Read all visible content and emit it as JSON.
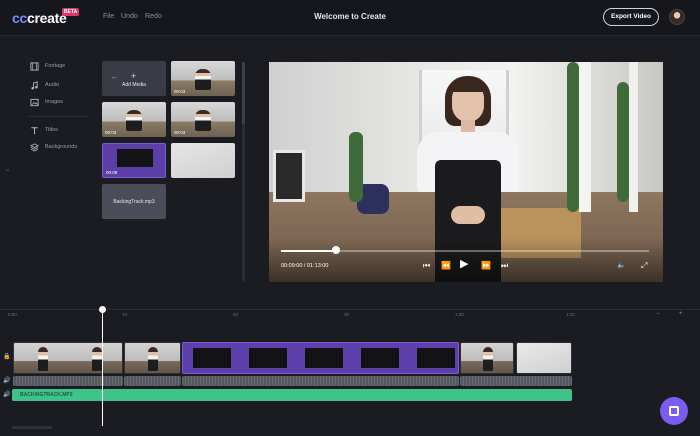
{
  "app": {
    "logo": "create",
    "logo_prefix": "cc",
    "badge": "BETA",
    "window_title": "Welcome to Create",
    "menu": [
      {
        "label": "File"
      },
      {
        "label": "Undo"
      },
      {
        "label": "Redo"
      }
    ],
    "export_label": "Export Video",
    "accent_color": "#7a5cf0"
  },
  "sidebar": {
    "items": [
      {
        "label": "Footage",
        "icon": "film-icon"
      },
      {
        "label": "Audio",
        "icon": "music-note-icon"
      },
      {
        "label": "Images",
        "icon": "image-icon"
      },
      {
        "label": "Titles",
        "icon": "text-icon"
      },
      {
        "label": "Backgrounds",
        "icon": "layers-icon"
      }
    ],
    "collapse_glyph": "«"
  },
  "media": {
    "add_label": "Add Media",
    "tiles": [
      {
        "kind": "video",
        "duration": "00:03"
      },
      {
        "kind": "video",
        "duration": "00:03"
      },
      {
        "kind": "video",
        "duration": "00:03"
      },
      {
        "kind": "title",
        "duration": "00:08"
      },
      {
        "kind": "image"
      },
      {
        "kind": "audio",
        "label": "BackingTrack.mp3"
      }
    ]
  },
  "preview": {
    "time": "00:09:00 / 01:13:00",
    "progress": 0.15
  },
  "timeline": {
    "ruler_ticks": [
      "0:00",
      "10",
      "20",
      "30",
      "1:00",
      "1:10"
    ],
    "zoom_out": "−",
    "zoom_in": "+",
    "audio_track_label": "BACKINGTRACK.MP3",
    "audio_color": "#3ec48a",
    "playhead_time": "0:07"
  }
}
